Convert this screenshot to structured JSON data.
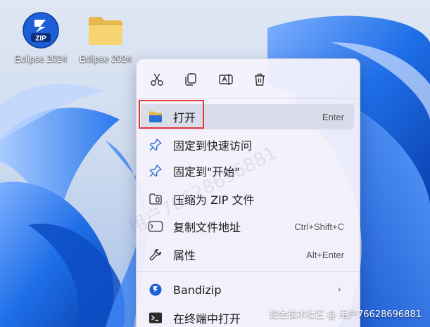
{
  "desktop": {
    "icons": [
      {
        "label": "Eclipse 2024",
        "icon": "zip-archive-icon",
        "badge": "ZIP"
      },
      {
        "label": "Eclipse 2024",
        "icon": "folder-icon"
      }
    ]
  },
  "context_menu": {
    "toolbar": [
      {
        "name": "cut",
        "icon": "scissors-icon"
      },
      {
        "name": "copy",
        "icon": "copy-icon"
      },
      {
        "name": "rename",
        "icon": "rename-icon"
      },
      {
        "name": "delete",
        "icon": "trash-icon"
      }
    ],
    "items": [
      {
        "label": "打开",
        "shortcut": "Enter",
        "icon": "folder-open-icon"
      },
      {
        "label": "固定到快速访问",
        "icon": "pin-icon"
      },
      {
        "label": "固定到\"开始\"",
        "icon": "pin-icon"
      },
      {
        "label": "压缩为 ZIP 文件",
        "icon": "zip-compress-icon"
      },
      {
        "label": "复制文件地址",
        "shortcut": "Ctrl+Shift+C",
        "icon": "copy-path-icon"
      },
      {
        "label": "属性",
        "shortcut": "Alt+Enter",
        "icon": "wrench-icon"
      },
      {
        "label": "Bandizip",
        "icon": "bandizip-icon",
        "submenu": true
      },
      {
        "label": "在终端中打开",
        "icon": "terminal-icon"
      }
    ]
  },
  "watermark": "用户76628696881",
  "credit": "掘金技术社区 @ 用户76628696881",
  "colors": {
    "highlight_border": "#e03a3a",
    "wallpaper_blue": "#1f6fe8",
    "accent_blue": "#0a5fc4"
  }
}
